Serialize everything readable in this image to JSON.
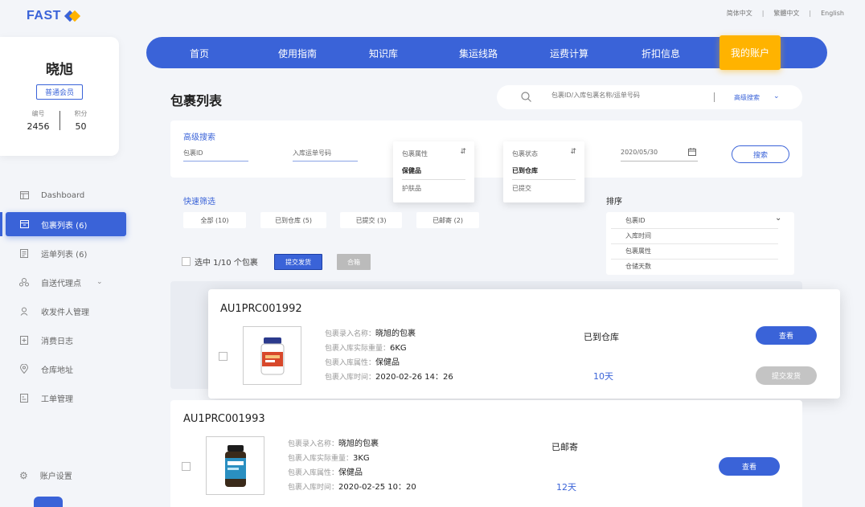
{
  "logo": {
    "text": "FAST"
  },
  "languages": [
    "简体中文",
    "繁體中文",
    "English"
  ],
  "profile": {
    "name": "晓旭",
    "level": "普通会员",
    "stats": [
      {
        "label": "编号",
        "value": "2456"
      },
      {
        "label": "积分",
        "value": "50"
      }
    ]
  },
  "sidebar": {
    "items": [
      {
        "label": "Dashboard",
        "icon": "dashboard-icon"
      },
      {
        "label": "包裹列表 (6)",
        "icon": "package-icon",
        "active": true
      },
      {
        "label": "运单列表 (6)",
        "icon": "waybill-icon"
      },
      {
        "label": "自送代理点",
        "icon": "agent-point-icon"
      },
      {
        "label": "收发件人管理",
        "icon": "contacts-icon"
      },
      {
        "label": "消费日志",
        "icon": "log-icon"
      },
      {
        "label": "仓库地址",
        "icon": "location-icon"
      },
      {
        "label": "工单管理",
        "icon": "ticket-icon"
      }
    ],
    "settings": "账户设置"
  },
  "topnav": {
    "tabs": [
      "首页",
      "使用指南",
      "知识库",
      "集运线路",
      "运费计算",
      "折扣信息",
      "我的账户"
    ]
  },
  "page": {
    "title": "包裹列表"
  },
  "search": {
    "placeholder": "包裹ID/入库包裹名称/运单号码",
    "advanced_label": "高级搜索"
  },
  "advanced": {
    "title": "高级搜索",
    "package_id_placeholder": "包裹ID",
    "tracking_placeholder": "入库运单号码",
    "attr_select": {
      "label": "包裹属性",
      "options": [
        "保健品",
        "护肤品"
      ]
    },
    "status_select": {
      "label": "包裹状态",
      "options": [
        "已到仓库",
        "已提交"
      ]
    },
    "date_value": "2020/05/30",
    "search_button": "搜索"
  },
  "quick_filter": {
    "title": "快速筛选",
    "chips": [
      "全部 (10)",
      "已到仓库 (5)",
      "已提交 (3)",
      "已邮寄 (2)"
    ]
  },
  "sort": {
    "title": "排序",
    "selected": "包裹ID",
    "options": [
      "入库时间",
      "包裹属性",
      "仓储天数"
    ]
  },
  "selection": {
    "text": "选中 1/10 个包裹",
    "submit_button": "提交发货",
    "merge_button": "合箱"
  },
  "labels": {
    "name": "包裹录入名称：",
    "weight": "包裹入库实际重量：",
    "attr": "包裹入库属性：",
    "time": "包裹入库时间："
  },
  "packages": [
    {
      "id": "AU1PRC001992",
      "name": "晓旭的包裹",
      "weight": "6KG",
      "attr": "保健品",
      "time": "2020-02-26 14：26",
      "status": "已到仓库",
      "days": "10天",
      "view_button": "查看",
      "submit_button": "提交发货"
    },
    {
      "id": "AU1PRC001993",
      "name": "晓旭的包裹",
      "weight": "3KG",
      "attr": "保健品",
      "time": "2020-02-25 10：20",
      "status": "已邮寄",
      "days": "12天",
      "view_button": "查看"
    }
  ],
  "colors": {
    "primary": "#3a63d8",
    "accent": "#ffb300"
  }
}
